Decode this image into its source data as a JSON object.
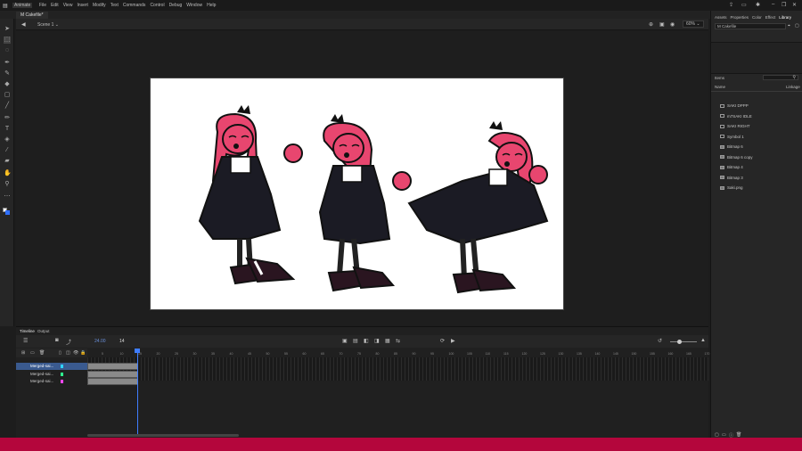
{
  "app": {
    "name": "Animate"
  },
  "menu": [
    "File",
    "Edit",
    "View",
    "Insert",
    "Modify",
    "Text",
    "Commands",
    "Control",
    "Debug",
    "Window",
    "Help"
  ],
  "document_tab": "M Cakefile*",
  "scene": {
    "label": "Scene 1"
  },
  "zoom": "60%",
  "right_panel": {
    "tabs": [
      "Assets",
      "Properties",
      "Color",
      "Effect",
      "Library"
    ],
    "active_tab": "Library",
    "doc_dropdown": "M Cakefile",
    "item_count": "Items",
    "col_name": "Name",
    "col_linkage": "Linkage",
    "items": [
      {
        "name": "SAKI DPPP",
        "kind": "symbol"
      },
      {
        "name": "m7SAKI IDLE",
        "kind": "symbol"
      },
      {
        "name": "SAKI RIGHT",
        "kind": "symbol"
      },
      {
        "name": "Symbol 1",
        "kind": "symbol"
      },
      {
        "name": "Bitmap 6",
        "kind": "bitmap"
      },
      {
        "name": "Bitmap 6 copy",
        "kind": "bitmap"
      },
      {
        "name": "Bitmap 4",
        "kind": "bitmap"
      },
      {
        "name": "Bitmap 3",
        "kind": "bitmap"
      },
      {
        "name": "Saki.png",
        "kind": "bitmap"
      }
    ]
  },
  "timeline": {
    "tabs": [
      "Timeline",
      "Output"
    ],
    "fps": "24.00",
    "frame": "14",
    "layers": [
      {
        "name": "Merged-sai...",
        "selected": true,
        "color": "#2fd3ff"
      },
      {
        "name": "Merged-sai...",
        "selected": false,
        "color": "#2fff8f"
      },
      {
        "name": "Merged-sai...",
        "selected": false,
        "color": "#ff47ff"
      }
    ],
    "ruler": [
      "5",
      "10",
      "15",
      "20",
      "25",
      "30",
      "35",
      "40",
      "45",
      "50",
      "55",
      "60",
      "65",
      "70",
      "75",
      "80",
      "85",
      "90",
      "95",
      "100",
      "105",
      "110",
      "115",
      "120",
      "125",
      "130",
      "135",
      "140",
      "145",
      "150",
      "155",
      "160",
      "165",
      "170"
    ]
  },
  "colors": {
    "accent": "#b4063c",
    "canvas": "#ffffff",
    "character_pink": "#e8466f",
    "dress": "#1b1b24"
  }
}
